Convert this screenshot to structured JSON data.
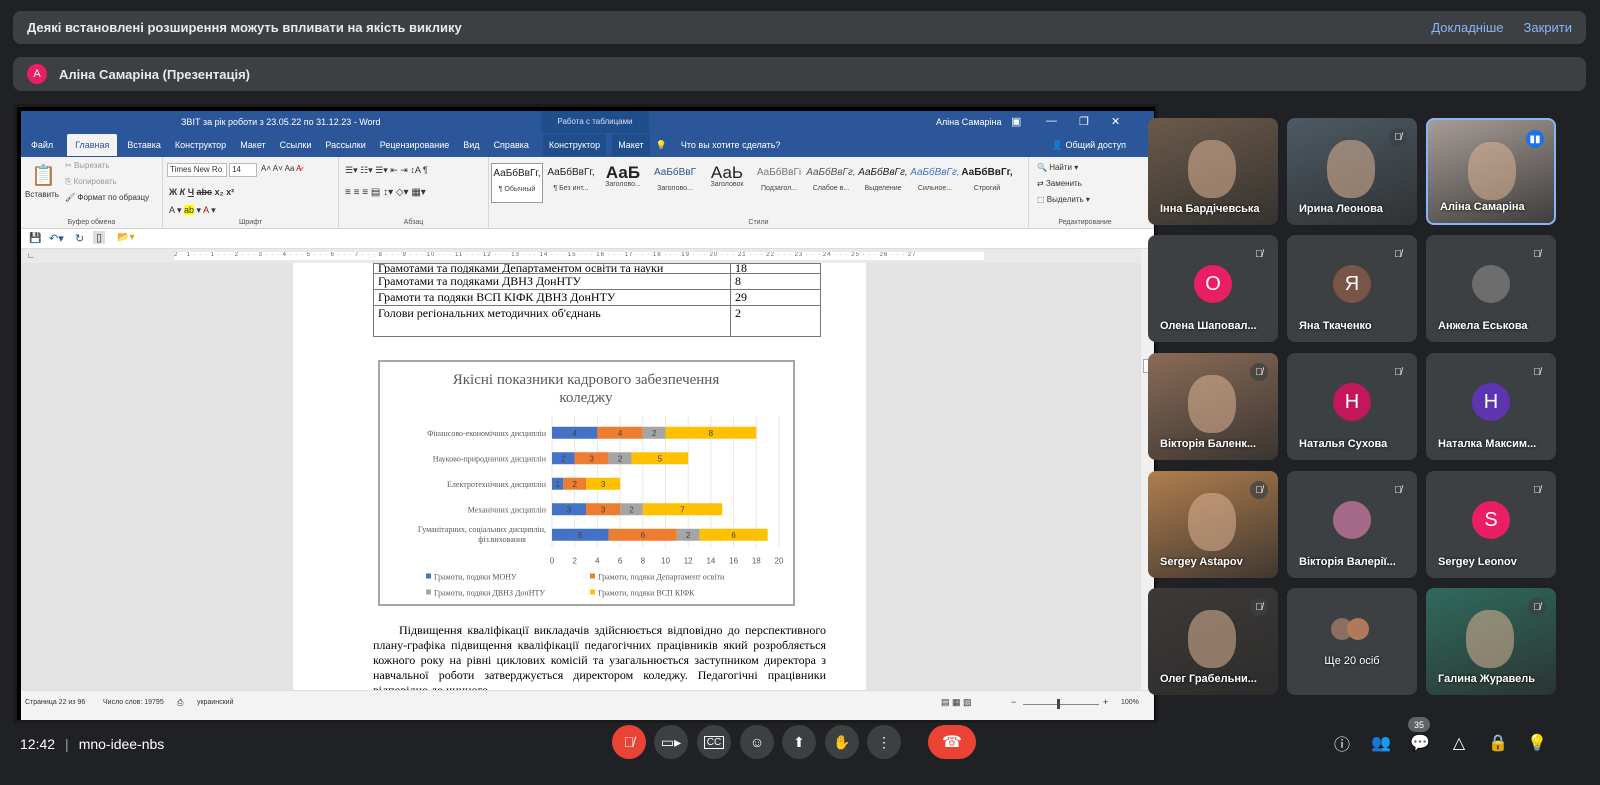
{
  "banner": {
    "text": "Деякі встановлені розширення можуть впливати на якість виклику",
    "more": "Докладніше",
    "close": "Закрити"
  },
  "presenter": {
    "initial": "А",
    "label": "Аліна Самаріна (Презентація)"
  },
  "word": {
    "title": "ЗВІТ за рік роботи з 23.05.22 по 31.12.23  -  Word",
    "context_tab": "Работа с таблицами",
    "user": "Аліна Самаріна",
    "menu": [
      "Файл",
      "Главная",
      "Вставка",
      "Конструктор",
      "Макет",
      "Ссылки",
      "Рассылки",
      "Рецензирование",
      "Вид",
      "Справка",
      "Конструктор",
      "Макет"
    ],
    "tell_me": "Что вы хотите сделать?",
    "share": "Общий доступ",
    "clipboard": {
      "paste": "Вставить",
      "cut": "Вырезать",
      "copy": "Копировать",
      "format": "Формат по образцу",
      "label": "Буфер обмена"
    },
    "font": {
      "name": "Times New Ro",
      "size": "14",
      "label": "Шрифт"
    },
    "paragraph_label": "Абзац",
    "styles": [
      {
        "preview": "АаБбВвГг,",
        "name": "¶ Обычный"
      },
      {
        "preview": "АаБбВвГг,",
        "name": "¶ Без инт..."
      },
      {
        "preview": "АаБ",
        "name": "Заголово..."
      },
      {
        "preview": "АаБбВвГ",
        "name": "Заголово..."
      },
      {
        "preview": "АаЬ",
        "name": "Заголовок"
      },
      {
        "preview": "АаБбВвГі",
        "name": "Подзагол..."
      },
      {
        "preview": "АаБбВвГг,",
        "name": "Слабое в..."
      },
      {
        "preview": "АаБбВвГг,",
        "name": "Выделение"
      },
      {
        "preview": "АаБбВвГг,",
        "name": "Сильное..."
      },
      {
        "preview": "АаБбВвГг,",
        "name": "Строгий"
      }
    ],
    "styles_label": "Стили",
    "editing": {
      "find": "Найти",
      "replace": "Заменить",
      "select": "Выделить",
      "label": "Редактирование"
    },
    "ruler_text": "2 · 1 · · · 1 · · · 2 · · · 3 · · · 4 · · · 5 · · · 6 · · · 7 · · · 8 · · · 9 · · · 10 · · · 11 · · · 12 · · · 13 · · · 14 · · · 15 · · · 16 · · · 17 · · · 18 · · · 19 · · · 20 · · · 21 · · · 22 · · · 23 · · · 24 · · · 25 · · · 26 · · · 27",
    "status": {
      "page": "Страница 22 из 96",
      "words": "Число слов: 19795",
      "lang": "украинский",
      "zoom": "100%"
    }
  },
  "doc_table": [
    {
      "label": "Грамотами та подяками Департаментом освіти та науки",
      "value": "18"
    },
    {
      "label": "Грамотами та подяками ДВНЗ ДонНТУ",
      "value": "8"
    },
    {
      "label": "Грамоти та подяки ВСП КІФК ДВНЗ ДонНТУ",
      "value": "29"
    },
    {
      "label": "Голови регіональних методичних об'єднань",
      "value": "2"
    }
  ],
  "chart_data": {
    "type": "bar",
    "orientation": "horizontal",
    "stacked": true,
    "title": "Якісні показники кадрового забезпечення коледжу",
    "categories": [
      "Фінансово-економічних дисциплін",
      "Науково-природничих дисциплін",
      "Електротехнічних дисциплін",
      "Механічних дисциплін",
      "Гуманітарних, соціальних дисциплін, фіз.виховання"
    ],
    "series": [
      {
        "name": "Грамоти, подяки МОНУ",
        "color": "#4472c4",
        "values": [
          4,
          2,
          1,
          3,
          5
        ]
      },
      {
        "name": "Грамоти, подяки Департамент освіти",
        "color": "#ed7d31",
        "values": [
          4,
          3,
          2,
          3,
          6
        ]
      },
      {
        "name": "Грамоти, подяки ДВНЗ ДонНТУ",
        "color": "#a5a5a5",
        "values": [
          2,
          2,
          0,
          2,
          2
        ]
      },
      {
        "name": "Грамоти, подяки ВСП КІФК",
        "color": "#ffc000",
        "values": [
          8,
          5,
          3,
          7,
          6
        ]
      }
    ],
    "xticks": [
      0,
      2,
      4,
      6,
      8,
      10,
      12,
      14,
      16,
      18,
      20
    ],
    "xlim": [
      0,
      20
    ],
    "grid": true,
    "legend": "bottom"
  },
  "paragraph": "Підвищення кваліфікації викладачів здійснюється відповідно до перспективного плану-графіка підвищення кваліфікації педагогічних працівників який розробляється кожного року на рівні циклових комісій та узагальнюється заступником директора з навчальної роботи затверджується директором коледжу. Педагогічні працівники відповідно до чинного",
  "participants": [
    {
      "name": "Інна Бардічевська",
      "muted": false,
      "video": true,
      "bg": "#6b5a4a"
    },
    {
      "name": "Ирина Леонова",
      "muted": true,
      "video": true,
      "bg": "#4d5a63"
    },
    {
      "name": "Аліна Самаріна",
      "muted": false,
      "speaking": true,
      "video": true,
      "bg": "#a79d97"
    },
    {
      "name": "Олена Шаповал...",
      "muted": true,
      "initial": "О",
      "color": "#e91e63"
    },
    {
      "name": "Яна Ткаченко",
      "muted": true,
      "initial": "Я",
      "color": "#795548"
    },
    {
      "name": "Анжела Еськова",
      "muted": true,
      "initial": "",
      "color": "#6d6d6d",
      "photo": true
    },
    {
      "name": "Вікторія Баленк...",
      "muted": true,
      "video": true,
      "bg": "#8a6b56"
    },
    {
      "name": "Наталья Сухова",
      "muted": true,
      "initial": "Н",
      "color": "#c2185b"
    },
    {
      "name": "Наталка Максим...",
      "muted": true,
      "initial": "Н",
      "color": "#5e35b1"
    },
    {
      "name": "Sergey Astapov",
      "muted": true,
      "video": true,
      "bg": "#b07e4e"
    },
    {
      "name": "Вікторія Валерії...",
      "muted": true,
      "initial": "",
      "color": "#a56a8a",
      "photo": true
    },
    {
      "name": "Sergey Leonov",
      "muted": true,
      "initial": "S",
      "color": "#e91e63"
    },
    {
      "name": "Олег Грабельни...",
      "muted": true,
      "video": true,
      "bg": "#3c3a38"
    },
    {
      "name": "Ще 20 осіб",
      "more": true
    },
    {
      "name": "Галина Журавель",
      "muted": true,
      "video": true,
      "bg": "#2f6b5d"
    }
  ],
  "bottom": {
    "time": "12:42",
    "code": "mno-idee-nbs",
    "people_count": "35"
  }
}
